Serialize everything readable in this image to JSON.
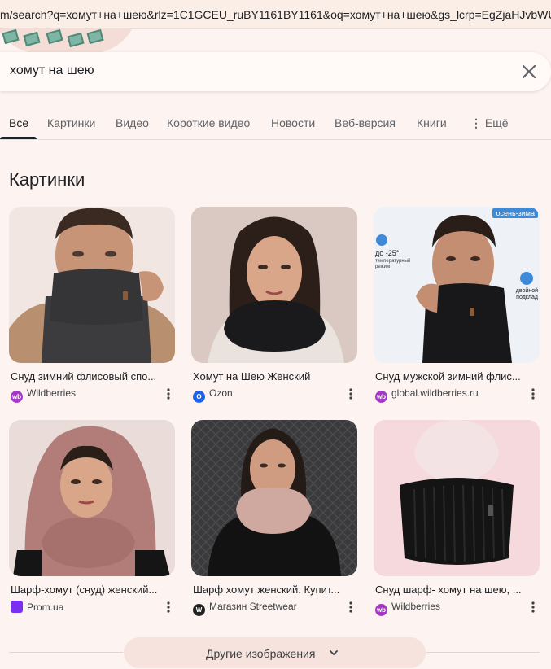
{
  "url": "m/search?q=хомут+на+шею&rlz=1C1GCEU_ruBY1161BY1161&oq=хомут+на+шею&gs_lcrp=EgZjaHJvbWUyB",
  "search": {
    "query": "хомут на шею"
  },
  "tabs": [
    {
      "label": "Все",
      "active": true
    },
    {
      "label": "Картинки"
    },
    {
      "label": "Видео"
    },
    {
      "label": "Короткие видео"
    },
    {
      "label": "Новости"
    },
    {
      "label": "Веб-версия"
    },
    {
      "label": "Книги"
    },
    {
      "label": "Ещё"
    }
  ],
  "section_title": "Картинки",
  "images": [
    {
      "title": "Снуд зимний флисовый спо...",
      "source": "Wildberries",
      "favicon": "wb",
      "favicon_color": "#a637c9"
    },
    {
      "title": "Хомут на Шею Женский",
      "source": "Ozon",
      "favicon": "ozon",
      "favicon_color": "#1a62f0"
    },
    {
      "title": "Снуд мужской зимний флис...",
      "source": "global.wildberries.ru",
      "favicon": "wb",
      "favicon_color": "#a637c9"
    },
    {
      "title": "Шарф-хомут (снуд) женский...",
      "source": "Prom.ua",
      "favicon": "prom",
      "favicon_color": "#7b2ff2"
    },
    {
      "title": "Шарф хомут женский. Купит...",
      "source": "Магазин Streetwear",
      "favicon": "sw",
      "favicon_color": "#222222"
    },
    {
      "title": "Снуд шарф- хомут на шею, ...",
      "source": "Wildberries",
      "favicon": "wb",
      "favicon_color": "#a637c9"
    }
  ],
  "badge_season": "осень-зима",
  "badge_temp": "до -25°",
  "badge_temp_note": "температурный режим",
  "badge_lining": "двойной подклад",
  "more_images_label": "Другие изображения"
}
